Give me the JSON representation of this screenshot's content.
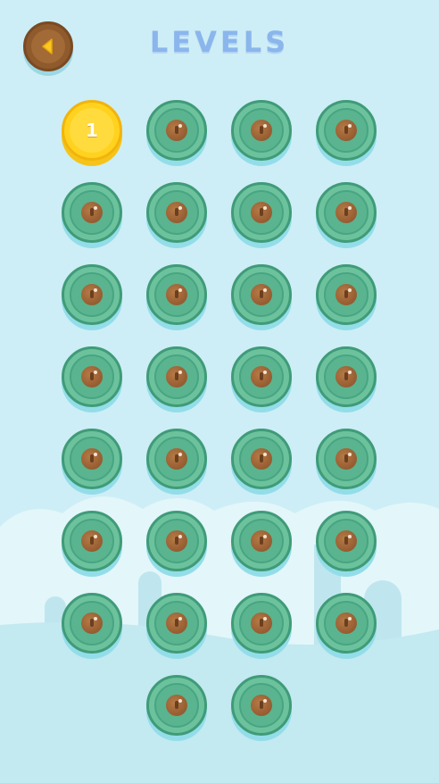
{
  "header": {
    "title": "LEVELS",
    "back_icon": "back-arrow-icon"
  },
  "levels": [
    {
      "label": "1",
      "state": "unlocked"
    },
    {
      "label": "",
      "state": "locked"
    },
    {
      "label": "",
      "state": "locked"
    },
    {
      "label": "",
      "state": "locked"
    },
    {
      "label": "",
      "state": "locked"
    },
    {
      "label": "",
      "state": "locked"
    },
    {
      "label": "",
      "state": "locked"
    },
    {
      "label": "",
      "state": "locked"
    },
    {
      "label": "",
      "state": "locked"
    },
    {
      "label": "",
      "state": "locked"
    },
    {
      "label": "",
      "state": "locked"
    },
    {
      "label": "",
      "state": "locked"
    },
    {
      "label": "",
      "state": "locked"
    },
    {
      "label": "",
      "state": "locked"
    },
    {
      "label": "",
      "state": "locked"
    },
    {
      "label": "",
      "state": "locked"
    },
    {
      "label": "",
      "state": "locked"
    },
    {
      "label": "",
      "state": "locked"
    },
    {
      "label": "",
      "state": "locked"
    },
    {
      "label": "",
      "state": "locked"
    },
    {
      "label": "",
      "state": "locked"
    },
    {
      "label": "",
      "state": "locked"
    },
    {
      "label": "",
      "state": "locked"
    },
    {
      "label": "",
      "state": "locked"
    },
    {
      "label": "",
      "state": "locked"
    },
    {
      "label": "",
      "state": "locked"
    },
    {
      "label": "",
      "state": "locked"
    },
    {
      "label": "",
      "state": "locked"
    },
    {
      "label": "",
      "state": "locked"
    },
    {
      "label": "",
      "state": "locked"
    }
  ],
  "colors": {
    "background": "#cdeef6",
    "locked_fill": "#6cc29c",
    "unlocked_fill": "#ffd21f",
    "back_button": "#8f5a2c",
    "back_arrow": "#ffc81e",
    "title": "#8ab6ec"
  },
  "icons": {
    "locked": "keyhole-lock-icon"
  }
}
